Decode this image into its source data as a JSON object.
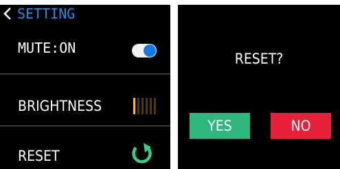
{
  "settings": {
    "title": "SETTING",
    "rows": {
      "mute": {
        "label": "MUTE:ON",
        "toggle_on": true
      },
      "brightness": {
        "label": "BRIGHTNESS",
        "level": 1,
        "max_level": 6
      },
      "reset": {
        "label": "RESET"
      }
    }
  },
  "reset_dialog": {
    "question": "RESET?",
    "yes_label": "YES",
    "no_label": "NO"
  },
  "colors": {
    "title_blue": "#1f8fe6",
    "toggle_knob": "#1479e6",
    "brightness_on": "#f5c518",
    "brightness_off": "#4a3a10",
    "reset_icon_green": "#2fd08a",
    "yes_green": "#2fb87e",
    "no_red": "#e8203a"
  },
  "icons": {
    "back": "chevron-left-icon",
    "reset": "refresh-arrow-icon"
  }
}
